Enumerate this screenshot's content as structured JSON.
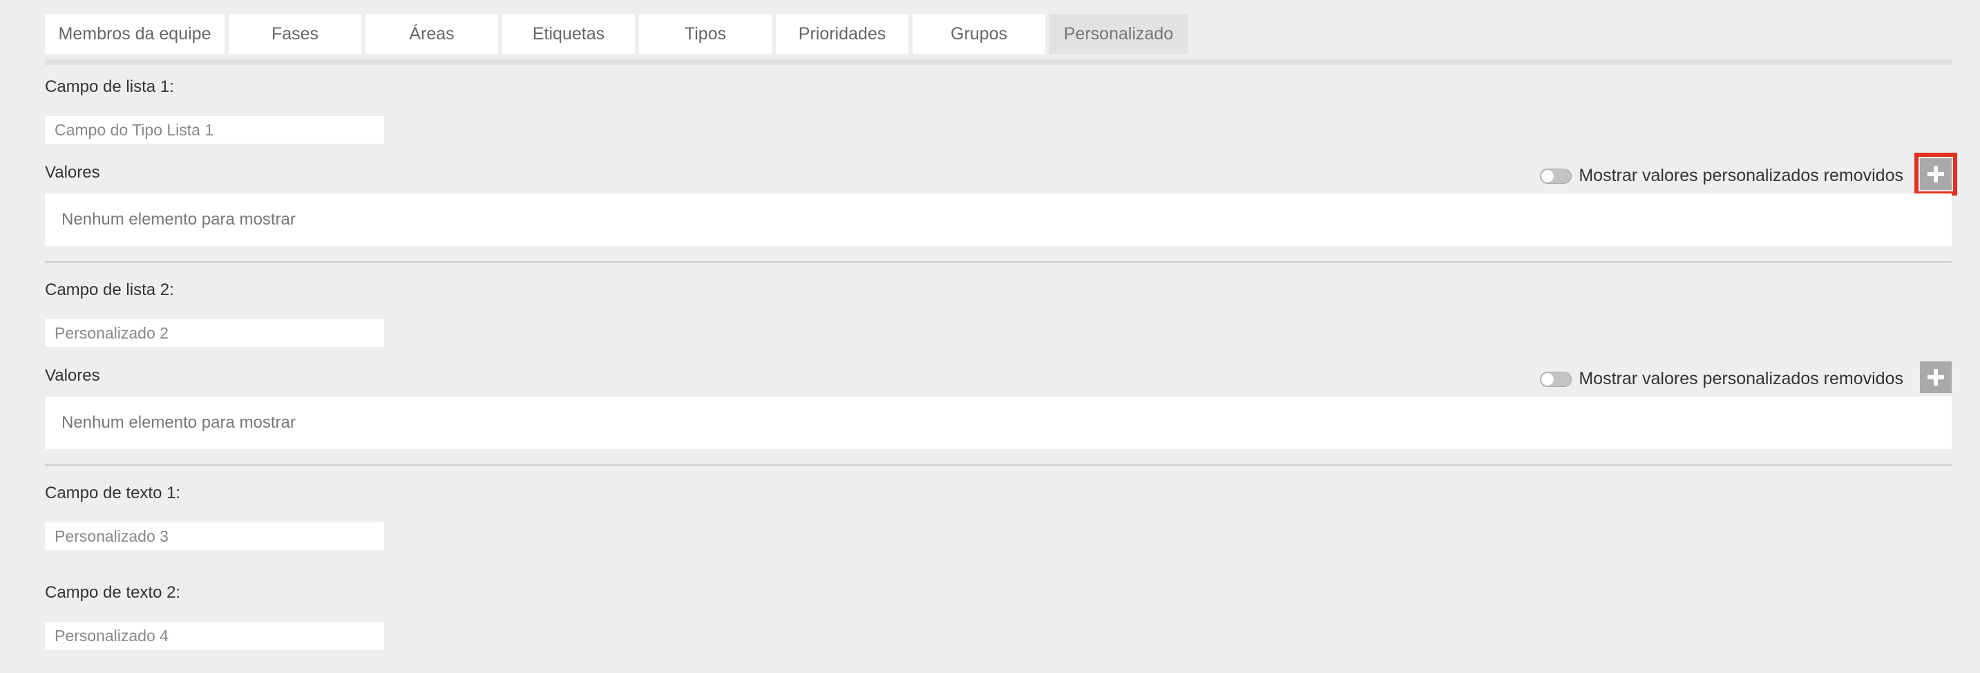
{
  "tabs": [
    {
      "label": "Membros da equipe"
    },
    {
      "label": "Fases"
    },
    {
      "label": "Áreas"
    },
    {
      "label": "Etiquetas"
    },
    {
      "label": "Tipos"
    },
    {
      "label": "Prioridades"
    },
    {
      "label": "Grupos"
    },
    {
      "label": "Personalizado"
    }
  ],
  "active_tab": "Personalizado",
  "list_fields": [
    {
      "label": "Campo de lista 1:",
      "placeholder": "Campo do Tipo Lista 1",
      "values_label": "Valores",
      "toggle_label": "Mostrar valores personalizados removidos",
      "empty_text": "Nenhum elemento para mostrar",
      "add_icon": "plus-icon"
    },
    {
      "label": "Campo de lista 2:",
      "placeholder": "Personalizado 2",
      "values_label": "Valores",
      "toggle_label": "Mostrar valores personalizados removidos",
      "empty_text": "Nenhum elemento para mostrar",
      "add_icon": "plus-icon"
    }
  ],
  "text_fields": [
    {
      "label": "Campo de texto 1:",
      "placeholder": "Personalizado 3"
    },
    {
      "label": "Campo de texto 2:",
      "placeholder": "Personalizado 4"
    }
  ],
  "colors": {
    "background": "#eeeeee",
    "active_tab": "#e2e2e2",
    "add_button": "#a9a9a9",
    "highlight": "#e0321f"
  }
}
